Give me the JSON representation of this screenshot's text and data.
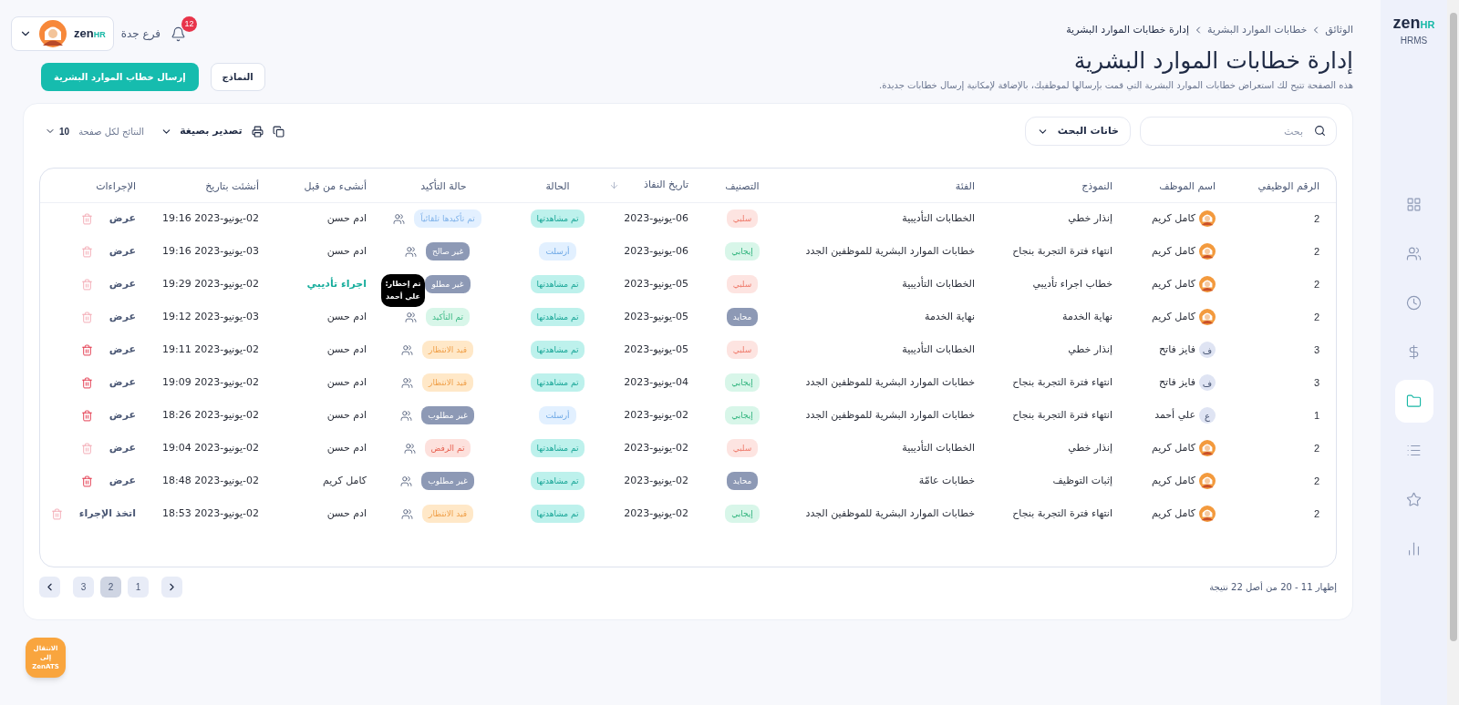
{
  "sidebar": {
    "logo": {
      "main": "zen",
      "sub": "HR",
      "caption": "HRMS"
    },
    "items": [
      {
        "kind": "grid",
        "selected": false
      },
      {
        "kind": "users",
        "selected": false
      },
      {
        "kind": "clock",
        "selected": false
      },
      {
        "kind": "dollar",
        "selected": false
      },
      {
        "kind": "folder",
        "selected": true
      },
      {
        "kind": "list",
        "selected": false
      },
      {
        "kind": "star",
        "selected": false
      },
      {
        "kind": "chart",
        "selected": false
      }
    ]
  },
  "header": {
    "breadcrumbs": [
      "الوثائق",
      "خطابات الموارد البشرية",
      "إدارة خطابات الموارد البشرية"
    ],
    "title": "إدارة خطابات الموارد البشرية",
    "description": "هذه الصفحة تتيح لك استعراض خطابات الموارد البشرية التي قمت بإرسالها لموظفيك، بالإضافة لإمكانية إرسال خطابات جديدة.",
    "notifications": "12",
    "branch": "فرع جدة",
    "user_logo": {
      "main": "zen",
      "sub": "HR"
    },
    "buttons": [
      {
        "label": "النماذج",
        "kind": "secondary"
      },
      {
        "label": "إرسال خطاب الموارد البشرية",
        "kind": "primary"
      }
    ]
  },
  "toolbar": {
    "search": {
      "placeholder": "بحث"
    },
    "search_columns": "خانات البحث",
    "export": "تصدير بصيغة",
    "page_size_label": "النتائج لكل صفحة",
    "page_size": "10"
  },
  "table": {
    "columns": [
      "الرقم الوظيفي",
      "اسم الموظف",
      "النموذج",
      "الفئة",
      "التصنيف",
      "تاريخ النفاذ",
      "الحالة",
      "حالة التأكيد",
      "أنشىء من قبل",
      "أنشئت بتاريخ",
      "الإجراءات"
    ],
    "rows": [
      {
        "id": "2",
        "employee": {
          "name": "كامل كريم"
        },
        "template": "إنذار خطي",
        "category": "الخطابات التأديبية",
        "classification": {
          "label": "سلبي",
          "kind": "negative"
        },
        "effective_date": "06-يونيو-2023",
        "status": {
          "label": "تم مشاهدتها",
          "kind": "viewed"
        },
        "confirmation": {
          "label": "تم تأكيدها تلقائياً",
          "kind": "auto"
        },
        "notify_icon": true,
        "created_by": {
          "label": "ادم حسن",
          "kind": "text"
        },
        "created_at": "02-يونيو-2023 19:16",
        "action": "عرض",
        "delete_enabled": false
      },
      {
        "id": "2",
        "employee": {
          "name": "كامل كريم"
        },
        "template": "انتهاء فترة التجربة بنجاح",
        "category": "خطابات الموارد البشرية للموظفين الجدد",
        "classification": {
          "label": "إيجابي",
          "kind": "positive"
        },
        "effective_date": "06-يونيو-2023",
        "status": {
          "label": "أرسلت",
          "kind": "sent"
        },
        "confirmation": {
          "label": "غير صالح",
          "kind": "invalid"
        },
        "notify_icon": true,
        "created_by": {
          "label": "ادم حسن",
          "kind": "text"
        },
        "created_at": "03-يونيو-2023 19:16",
        "action": "عرض",
        "delete_enabled": false
      },
      {
        "id": "2",
        "employee": {
          "name": "كامل كريم"
        },
        "template": "خطاب اجراء تأديبي",
        "category": "الخطابات التأديبية",
        "classification": {
          "label": "سلبي",
          "kind": "negative"
        },
        "effective_date": "05-يونيو-2023",
        "status": {
          "label": "تم مشاهدتها",
          "kind": "viewed"
        },
        "confirmation": {
          "label": "غير مطلو",
          "kind": "not_required"
        },
        "notify_icon": false,
        "created_by": {
          "label": "اجراء تأديبي",
          "kind": "link"
        },
        "created_at": "02-يونيو-2023 19:29",
        "action": "عرض",
        "delete_enabled": false
      },
      {
        "id": "2",
        "employee": {
          "name": "كامل كريم"
        },
        "template": "نهاية الخدمة",
        "category": "نهاية الخدمة",
        "classification": {
          "label": "محايد",
          "kind": "neutral"
        },
        "effective_date": "05-يونيو-2023",
        "status": {
          "label": "تم مشاهدتها",
          "kind": "viewed"
        },
        "confirmation": {
          "label": "تم التأكيد",
          "kind": "confirmed"
        },
        "notify_icon": true,
        "tooltip": "تم إخطار: علي أحمد",
        "created_by": {
          "label": "ادم حسن",
          "kind": "text"
        },
        "created_at": "03-يونيو-2023 19:12",
        "action": "عرض",
        "delete_enabled": false
      },
      {
        "id": "3",
        "employee": {
          "name": "فايز فاتح",
          "avatar": {
            "kind": "letter",
            "letter": "ف"
          }
        },
        "template": "إنذار خطي",
        "category": "الخطابات التأديبية",
        "classification": {
          "label": "سلبي",
          "kind": "negative"
        },
        "effective_date": "05-يونيو-2023",
        "status": {
          "label": "تم مشاهدتها",
          "kind": "viewed"
        },
        "confirmation": {
          "label": "قيد الانتظار",
          "kind": "pending"
        },
        "notify_icon": true,
        "created_by": {
          "label": "ادم حسن",
          "kind": "text"
        },
        "created_at": "02-يونيو-2023 19:11",
        "action": "عرض",
        "delete_enabled": true
      },
      {
        "id": "3",
        "employee": {
          "name": "فايز فاتح",
          "avatar": {
            "kind": "letter",
            "letter": "ف"
          }
        },
        "template": "انتهاء فترة التجربة بنجاح",
        "category": "خطابات الموارد البشرية للموظفين الجدد",
        "classification": {
          "label": "إيجابي",
          "kind": "positive"
        },
        "effective_date": "04-يونيو-2023",
        "status": {
          "label": "تم مشاهدتها",
          "kind": "viewed"
        },
        "confirmation": {
          "label": "قيد الانتظار",
          "kind": "pending"
        },
        "notify_icon": true,
        "created_by": {
          "label": "ادم حسن",
          "kind": "text"
        },
        "created_at": "02-يونيو-2023 19:09",
        "action": "عرض",
        "delete_enabled": true
      },
      {
        "id": "1",
        "employee": {
          "name": "علي أحمد",
          "avatar": {
            "kind": "letter",
            "letter": "ع"
          }
        },
        "template": "انتهاء فترة التجربة بنجاح",
        "category": "خطابات الموارد البشرية للموظفين الجدد",
        "classification": {
          "label": "إيجابي",
          "kind": "positive"
        },
        "effective_date": "02-يونيو-2023",
        "status": {
          "label": "أرسلت",
          "kind": "sent"
        },
        "confirmation": {
          "label": "غير مطلوب",
          "kind": "not_required"
        },
        "notify_icon": true,
        "created_by": {
          "label": "ادم حسن",
          "kind": "text"
        },
        "created_at": "02-يونيو-2023 18:26",
        "action": "عرض",
        "delete_enabled": true
      },
      {
        "id": "2",
        "employee": {
          "name": "كامل كريم"
        },
        "template": "إنذار خطي",
        "category": "الخطابات التأديبية",
        "classification": {
          "label": "سلبي",
          "kind": "negative"
        },
        "effective_date": "02-يونيو-2023",
        "status": {
          "label": "تم مشاهدتها",
          "kind": "viewed"
        },
        "confirmation": {
          "label": "تم الرفض",
          "kind": "rejected"
        },
        "notify_icon": true,
        "created_by": {
          "label": "ادم حسن",
          "kind": "text"
        },
        "created_at": "02-يونيو-2023 19:04",
        "action": "عرض",
        "delete_enabled": false
      },
      {
        "id": "2",
        "employee": {
          "name": "كامل كريم"
        },
        "template": "إثبات التوظيف",
        "category": "خطابات عامّة",
        "classification": {
          "label": "محايد",
          "kind": "neutral"
        },
        "effective_date": "02-يونيو-2023",
        "status": {
          "label": "تم مشاهدتها",
          "kind": "viewed"
        },
        "confirmation": {
          "label": "غير مطلوب",
          "kind": "not_required"
        },
        "notify_icon": true,
        "created_by": {
          "label": "كامل كريم",
          "kind": "text"
        },
        "created_at": "02-يونيو-2023 18:48",
        "action": "عرض",
        "delete_enabled": true
      },
      {
        "id": "2",
        "employee": {
          "name": "كامل كريم"
        },
        "template": "انتهاء فترة التجربة بنجاح",
        "category": "خطابات الموارد البشرية للموظفين الجدد",
        "classification": {
          "label": "إيجابي",
          "kind": "positive"
        },
        "effective_date": "02-يونيو-2023",
        "status": {
          "label": "تم مشاهدتها",
          "kind": "viewed"
        },
        "confirmation": {
          "label": "قيد الانتظار",
          "kind": "pending"
        },
        "notify_icon": true,
        "created_by": {
          "label": "ادم حسن",
          "kind": "text"
        },
        "created_at": "02-يونيو-2023 18:53",
        "action": "اتخذ الإجراء",
        "delete_enabled": false
      }
    ]
  },
  "pagination": {
    "summary": "إظهار 11 - 20 من أصل 22 نتيجة",
    "pages": [
      {
        "label": "1",
        "selected": false
      },
      {
        "label": "2",
        "selected": true
      },
      {
        "label": "3",
        "selected": false
      }
    ]
  },
  "ats_button": {
    "label": "الانتقال إلى ZenATS"
  }
}
